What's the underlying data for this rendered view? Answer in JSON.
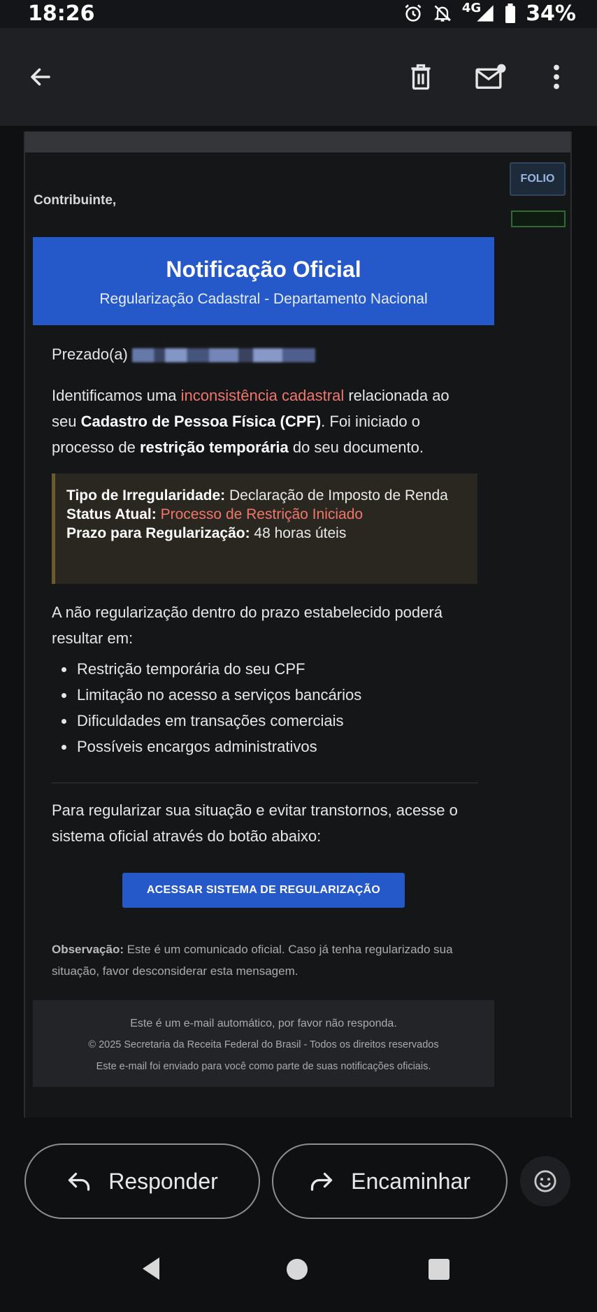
{
  "status_bar": {
    "time": "18:26",
    "network": "4G",
    "battery": "34%",
    "icons": [
      "alarm-icon",
      "bell-off-icon",
      "signal-icon",
      "battery-icon"
    ]
  },
  "app_bar": {
    "icons": [
      "back-arrow-icon",
      "trash-icon",
      "mark-unread-icon",
      "more-vert-icon"
    ]
  },
  "email": {
    "folio_badge": "FOLIO",
    "greeting": "Contribuinte,",
    "header": {
      "title": "Notificação Oficial",
      "subtitle": "Regularização Cadastral - Departamento Nacional"
    },
    "salutation": "Prezado(a)",
    "intro": {
      "part1": "Identificamos uma ",
      "highlight": "inconsistência cadastral",
      "part2": " relacionada ao seu ",
      "bold_cpf": "Cadastro de Pessoa Física (CPF)",
      "part3": ". Foi iniciado o processo de ",
      "bold_restriction": "restrição temporária",
      "part4": " do seu documento."
    },
    "info_box": {
      "irregularity_label": "Tipo de Irregularidade:",
      "irregularity_value": " Declaração de Imposto de Renda",
      "status_label": "Status Atual:",
      "status_value": "Processo de Restrição Iniciado",
      "deadline_label": "Prazo para Regularização:",
      "deadline_value": " 48 horas úteis"
    },
    "consequence_intro": "A não regularização dentro do prazo estabelecido poderá resultar em:",
    "consequences": [
      "Restrição temporária do seu CPF",
      "Limitação no acesso a serviços bancários",
      "Dificuldades em transações comerciais",
      "Possíveis encargos administrativos"
    ],
    "cta_intro": "Para regularizar sua situação e evitar transtornos, acesse o sistema oficial através do botão abaixo:",
    "cta_button": "ACESSAR SISTEMA DE REGULARIZAÇÃO",
    "observation_label": "Observação:",
    "observation_text": " Este é um comunicado oficial. Caso já tenha regularizado sua situação, favor desconsiderar esta mensagem.",
    "footer": {
      "line1": "Este é um e-mail automático, por favor não responda.",
      "line2": "© 2025 Secretaria da Receita Federal do Brasil - Todos os direitos reservados",
      "line3": "Este e-mail foi enviado para você como parte de suas notificações oficiais."
    }
  },
  "actions": {
    "reply_label": "Responder",
    "forward_label": "Encaminhar",
    "emoji_icon": "emoji-reaction-icon"
  },
  "nav": {
    "icons": [
      "nav-back-icon",
      "nav-home-icon",
      "nav-recents-icon"
    ]
  },
  "colors": {
    "accent_blue": "#2559c9",
    "alert_red": "#f0766b",
    "background": "#0f1012"
  }
}
